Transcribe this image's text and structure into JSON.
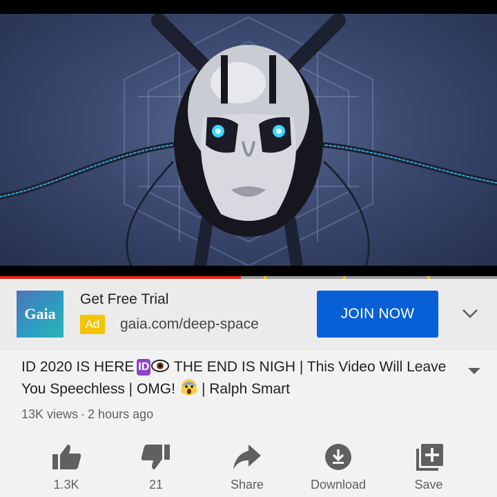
{
  "video": {
    "progress_fraction": 0.485,
    "ad_markers": [
      0.53,
      0.69,
      0.86
    ]
  },
  "ad": {
    "logo_text": "Gaia",
    "title": "Get Free Trial",
    "badge": "Ad",
    "url": "gaia.com/deep-space",
    "cta": "JOIN NOW",
    "expand_icon": "chevron-down-icon"
  },
  "title": {
    "part1": "ID 2020 IS HERE",
    "id_emoji": "ID",
    "part2": "THE END IS NIGH | This Video Will Leave You Speechless | OMG!",
    "part3": "| Ralph Smart",
    "expand_icon": "caret-down-icon"
  },
  "meta": {
    "views": "13K views",
    "separator": "·",
    "time": "2 hours ago"
  },
  "actions": [
    {
      "icon": "thumbs-up-icon",
      "label": "1.3K"
    },
    {
      "icon": "thumbs-down-icon",
      "label": "21"
    },
    {
      "icon": "share-icon",
      "label": "Share"
    },
    {
      "icon": "download-icon",
      "label": "Download"
    },
    {
      "icon": "save-playlist-icon",
      "label": "Save"
    }
  ],
  "colors": {
    "progress": "#e62117",
    "ad_marker": "#f4c300",
    "cta": "#065fd4",
    "ad_badge": "#f4c400"
  }
}
